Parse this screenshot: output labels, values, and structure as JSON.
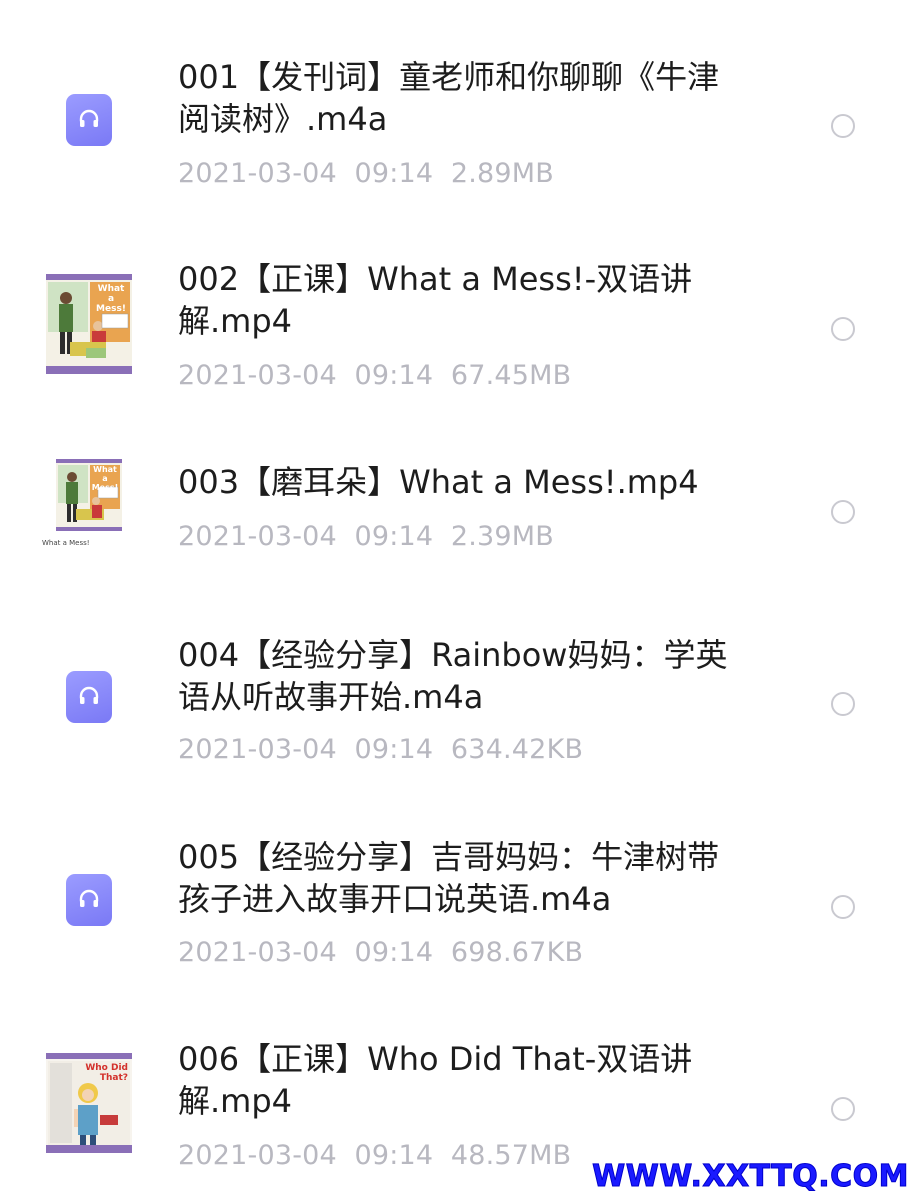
{
  "files": [
    {
      "title": "001【发刊词】童老师和你聊聊《牛津\n阅读树》.m4a",
      "date": "2021-03-04",
      "time": "09:14",
      "size": "2.89MB",
      "icon": "audio-icon"
    },
    {
      "title": "002【正课】What a Mess!-双语讲\n解.mp4",
      "date": "2021-03-04",
      "time": "09:14",
      "size": "67.45MB",
      "icon": "book-cover-thumbnail"
    },
    {
      "title": "003【磨耳朵】What a Mess!.mp4",
      "date": "2021-03-04",
      "time": "09:14",
      "size": "2.39MB",
      "icon": "book-cover-thumbnail"
    },
    {
      "title": "004【经验分享】Rainbow妈妈：学英\n语从听故事开始.m4a",
      "date": "2021-03-04",
      "time": "09:14",
      "size": "634.42KB",
      "icon": "audio-icon"
    },
    {
      "title": "005【经验分享】吉哥妈妈：牛津树带\n孩子进入故事开口说英语.m4a",
      "date": "2021-03-04",
      "time": "09:14",
      "size": "698.67KB",
      "icon": "audio-icon"
    },
    {
      "title": "006【正课】Who Did That-双语讲\n解.mp4",
      "date": "2021-03-04",
      "time": "09:14",
      "size": "48.57MB",
      "icon": "book-cover-thumbnail"
    }
  ],
  "covers": {
    "mess_title": "What a Mess!",
    "mess_caption": "What a Mess!",
    "who_title": "Who Did That?"
  },
  "watermark": "WWW.XXTTQ.COM",
  "colors": {
    "accent": "#8a8af7",
    "title": "#1d1d1d",
    "meta": "#b8b8c0",
    "watermark": "#1a1aff"
  }
}
